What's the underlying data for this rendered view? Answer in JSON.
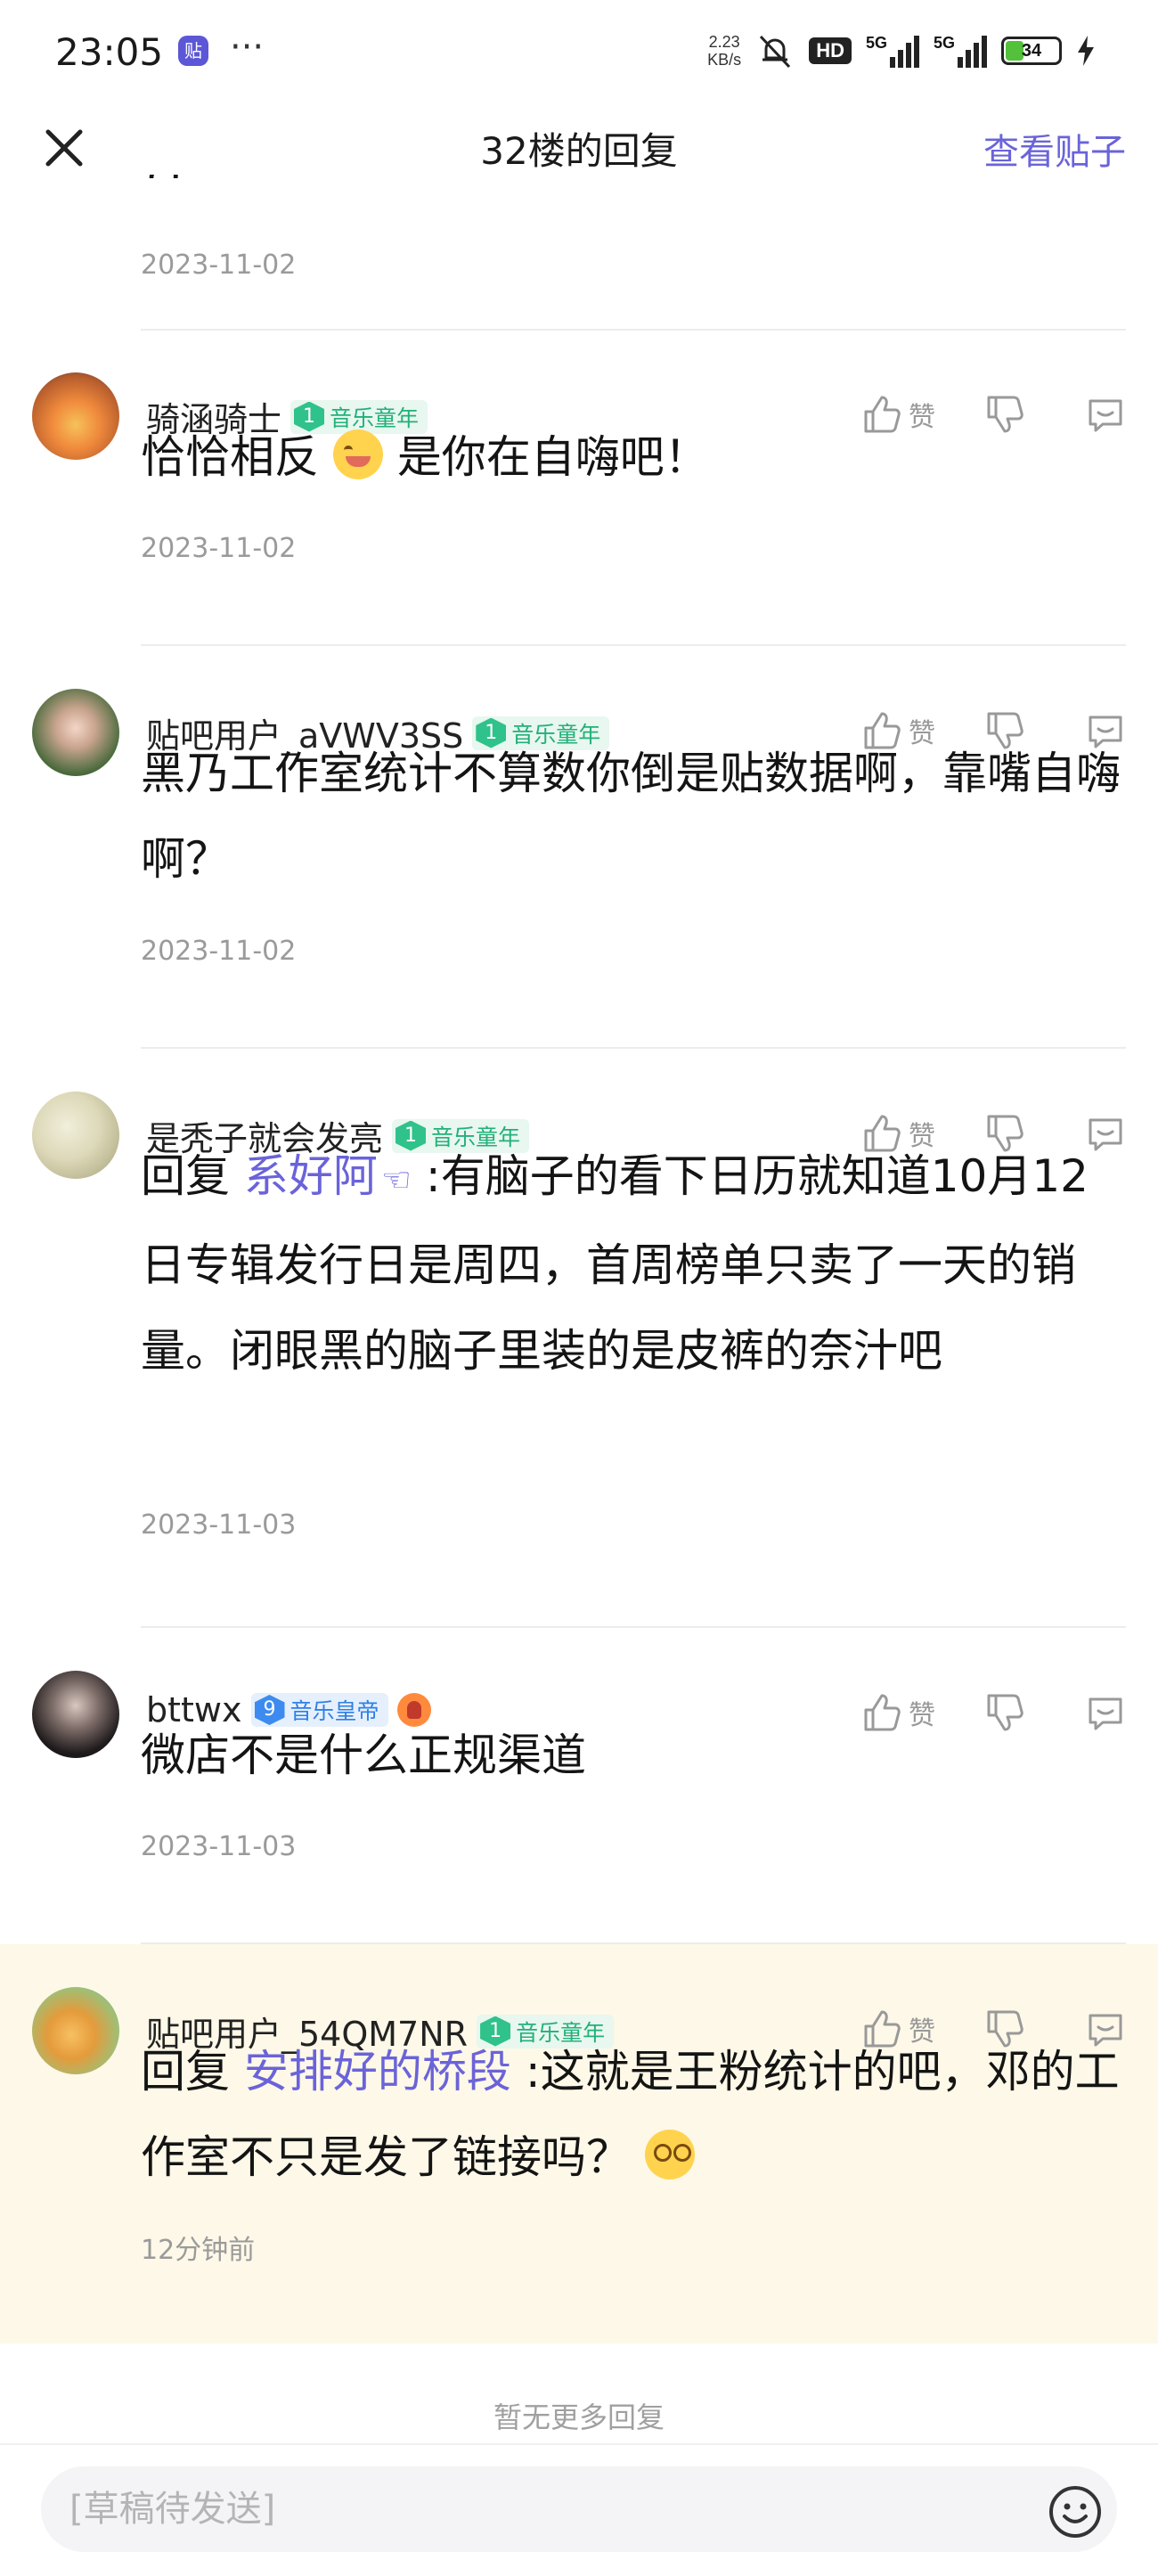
{
  "status_bar": {
    "time": "23:05",
    "app_icon_text": "贴",
    "more": "···",
    "net_speed_value": "2.23",
    "net_speed_unit": "KB/s",
    "hd": "HD",
    "sig1": "5G",
    "sig2": "5G",
    "battery": "34",
    "battery_level": 0.34
  },
  "header": {
    "title": "32楼的回复",
    "view_post": "查看贴子"
  },
  "replies": [
    {
      "username": "",
      "content_fragment": "?)",
      "time": "2023-11-02"
    },
    {
      "username": "骑涵骑士",
      "level": "1",
      "badge": "音乐童年",
      "like": "赞",
      "content_a": "恰恰相反",
      "content_b": "是你在自嗨吧！",
      "time": "2023-11-02"
    },
    {
      "username": "贴吧用户_aVWV3SS",
      "level": "1",
      "badge": "音乐童年",
      "like": "赞",
      "content": "黑乃工作室统计不算数你倒是贴数据啊，靠嘴自嗨啊？",
      "time": "2023-11-02"
    },
    {
      "username": "是秃子就会发亮",
      "level": "1",
      "badge": "音乐童年",
      "like": "赞",
      "reply_prefix": "回复",
      "mention": "系好阿",
      "content": ":有脑子的看下日历就知道10月12日专辑发行日是周四，首周榜单只卖了一天的销量。闭眼黑的脑子里装的是皮裤的奈汁吧",
      "time": "2023-11-03"
    },
    {
      "username": "bttwx",
      "level": "9",
      "badge": "音乐皇帝",
      "like": "赞",
      "content": "微店不是什么正规渠道",
      "time": "2023-11-03"
    },
    {
      "username": "贴吧用户_54QM7NR",
      "level": "1",
      "badge": "音乐童年",
      "like": "赞",
      "reply_prefix": "回复",
      "mention": "安排好的桥段",
      "content": ":这就是王粉统计的吧，邓的工作室不只是发了链接吗？",
      "time": "12分钟前"
    }
  ],
  "footer": {
    "no_more": "暂无更多回复",
    "draft_placeholder": "[草稿待发送]"
  },
  "colors": {
    "accent": "#6a63d9",
    "badge_green": "#22b07a",
    "badge_blue": "#2f7fe6",
    "highlight_bg": "#fdf8e8"
  }
}
